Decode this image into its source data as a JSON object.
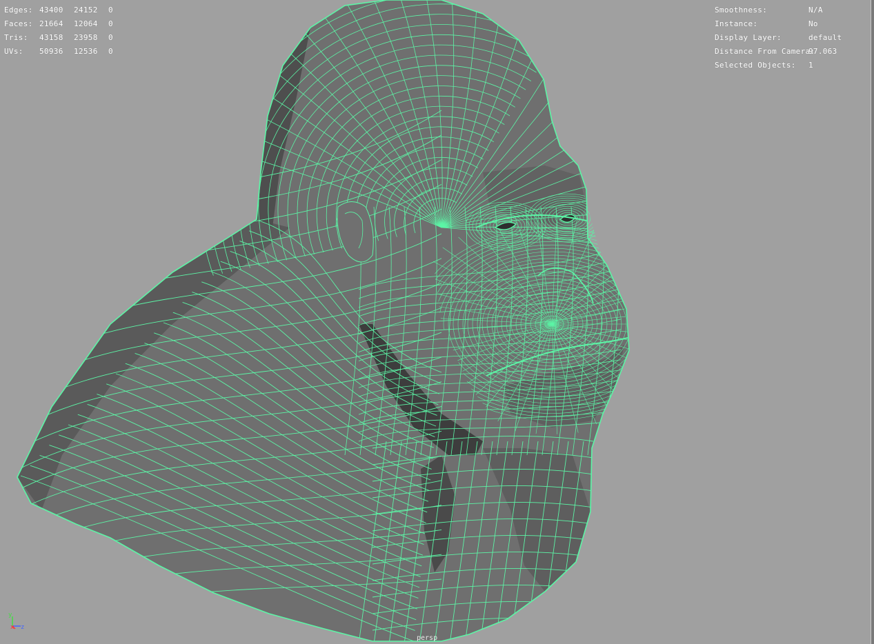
{
  "viewport": {
    "camera_label": "persp",
    "background_color": "#a0a0a0",
    "wire_color": "#5cf5a6",
    "mesh_color": "#6c6c6c"
  },
  "hud_left": {
    "rows": [
      {
        "label": "Edges:",
        "v1": "43400",
        "v2": "24152",
        "v3": "0"
      },
      {
        "label": "Faces:",
        "v1": "21664",
        "v2": "12064",
        "v3": "0"
      },
      {
        "label": "Tris:",
        "v1": "43158",
        "v2": "23958",
        "v3": "0"
      },
      {
        "label": "UVs:",
        "v1": "50936",
        "v2": "12536",
        "v3": "0"
      }
    ]
  },
  "hud_right": {
    "rows": [
      {
        "label": "Smoothness:",
        "value": "N/A"
      },
      {
        "label": "Instance:",
        "value": "No"
      },
      {
        "label": "Display Layer:",
        "value": "default"
      },
      {
        "label": "Distance From Camera:",
        "value": "97.063"
      },
      {
        "label": "Selected Objects:",
        "value": "1"
      }
    ]
  },
  "axis": {
    "x_label": "x",
    "y_label": "y",
    "z_label": "z"
  },
  "icons": {
    "axis_gizmo": "axis-gizmo-icon",
    "model": "wireframe-gorilla-head-model"
  }
}
